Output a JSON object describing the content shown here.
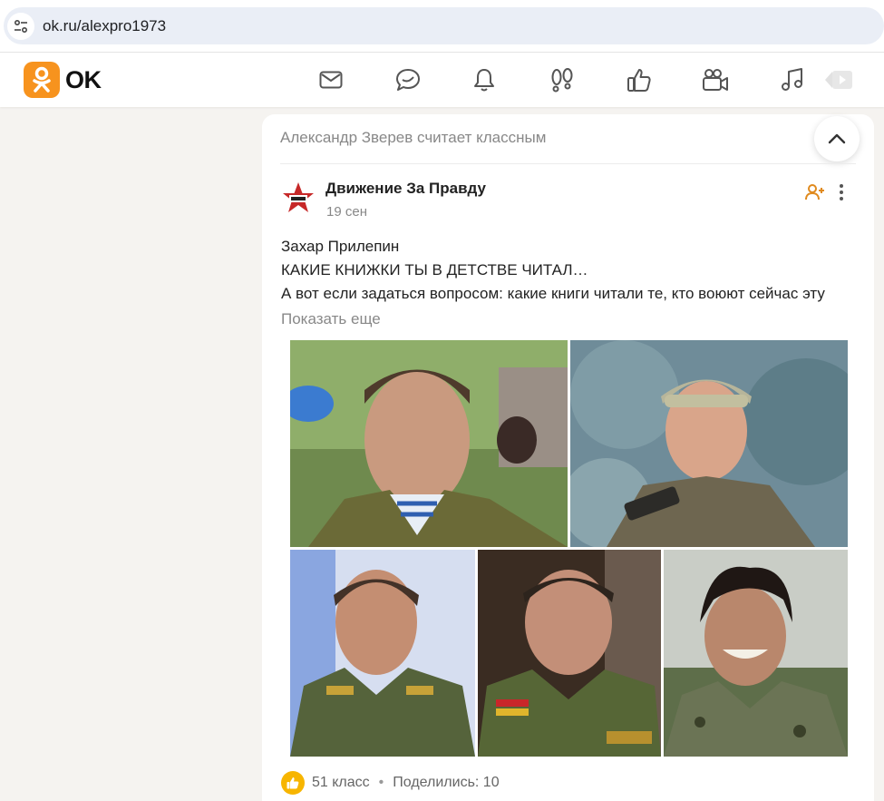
{
  "browser": {
    "url": "ok.ru/alexpro1973"
  },
  "header": {
    "logo_text": "OK",
    "nav_icons": [
      "mail-icon",
      "chat-icon",
      "bell-icon",
      "guests-icon",
      "like-thumb-icon",
      "video-camera-icon",
      "music-note-icon",
      "video-play-icon"
    ],
    "accent_color": "#f7931e"
  },
  "card": {
    "top_text": "Александр Зверев считает классным",
    "group_name": "Движение За Правду",
    "date": "19 сен",
    "author": "Захар Прилепин",
    "title": "КАКИЕ КНИЖКИ ТЫ В ДЕТСТВЕ ЧИТАЛ…",
    "body": "А вот если задаться вопросом: какие книги читали те, кто воюют сейчас эту",
    "show_more": "Показать еще",
    "likes_text": "51 класс",
    "separator": "•",
    "shares_text": "Поделились: 10"
  }
}
